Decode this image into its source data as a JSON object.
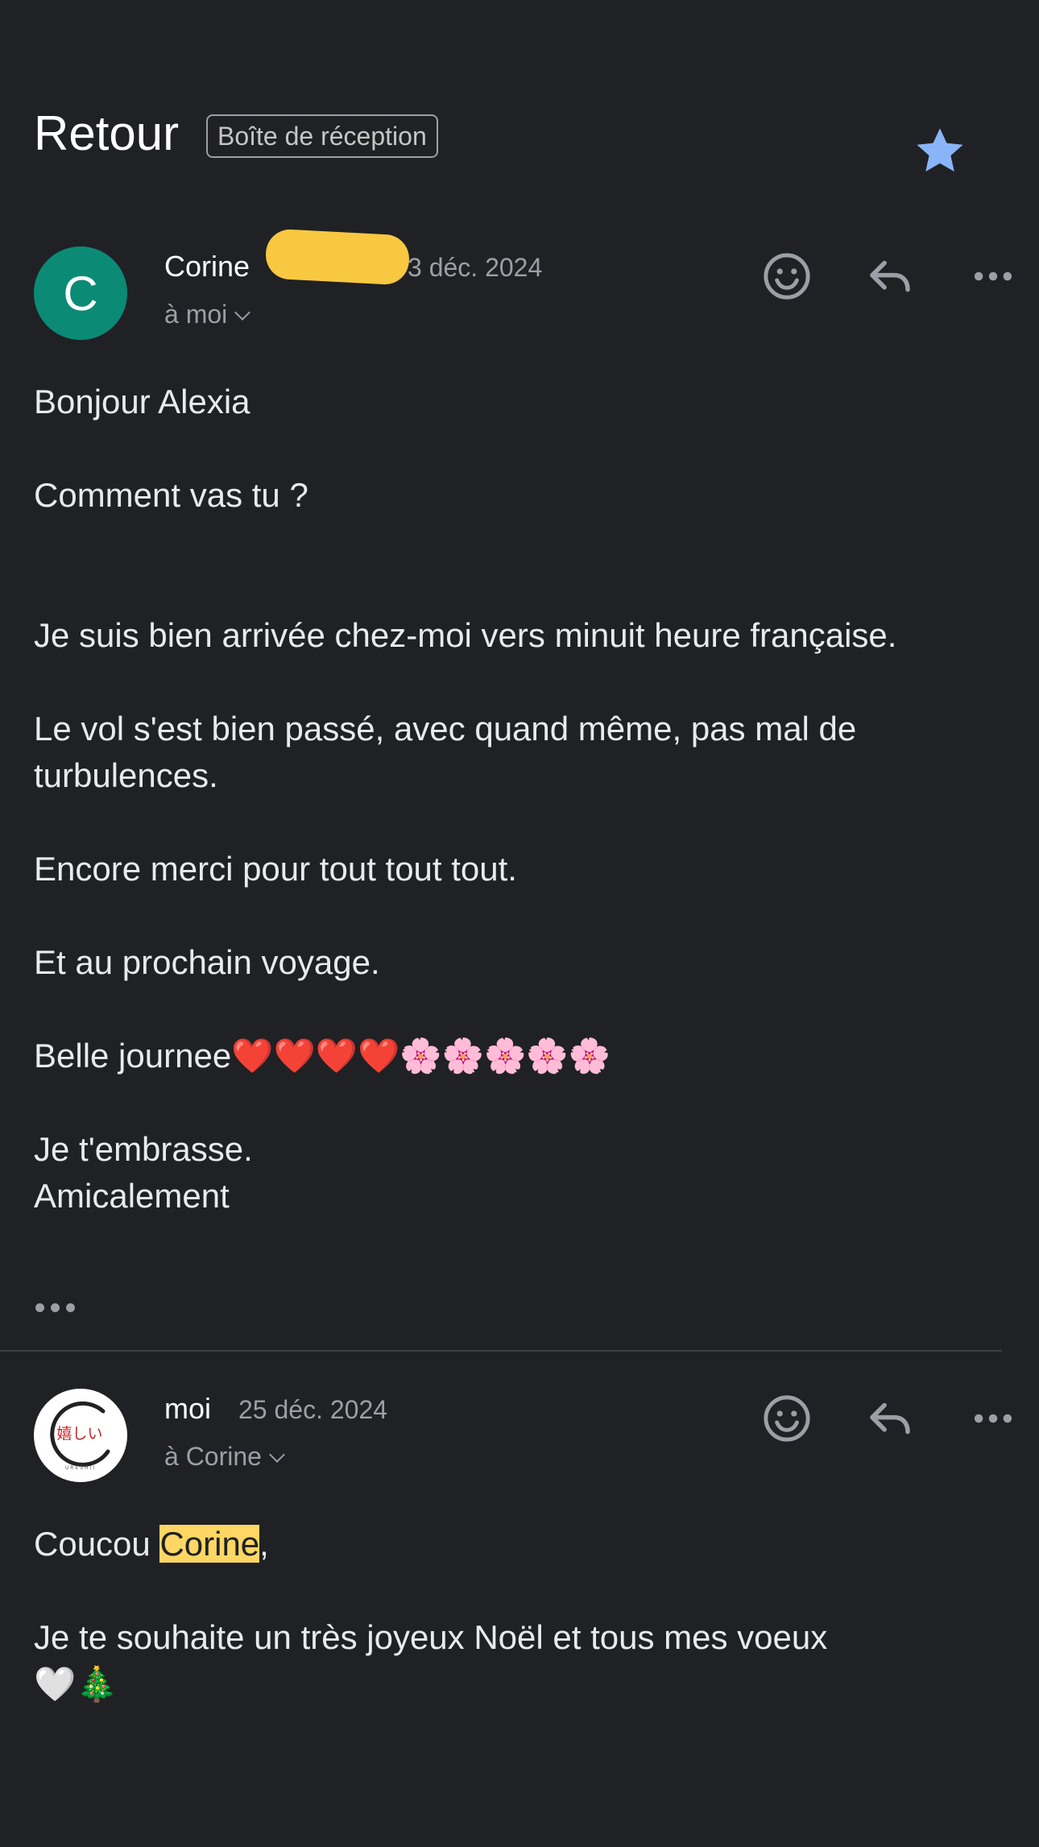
{
  "header": {
    "back_title": "Retour",
    "folder_label": "Boîte de réception",
    "starred": true,
    "star_color": "#8ab4f8"
  },
  "messages": [
    {
      "avatar_letter": "C",
      "avatar_color": "#0b8a76",
      "sender": "Corine",
      "date": "3 déc. 2024",
      "to": "à moi",
      "redacted": true,
      "body": [
        "Bonjour Alexia",
        "Comment vas tu ?",
        "Je suis bien arrivée chez-moi vers minuit heure française.",
        "Le vol s'est bien passé, avec quand même, pas mal de turbulences.",
        "Encore merci pour tout tout tout.",
        "Et au prochain voyage.",
        "Belle journee❤️❤️❤️❤️🌸🌸🌸🌸🌸",
        "Je t'embrasse.",
        "Amicalement"
      ]
    },
    {
      "avatar_logo_text": "嬉しい",
      "avatar_logo_caption": "URESHII",
      "sender": "moi",
      "date": "25 déc. 2024",
      "to": "à Corine",
      "greeting_prefix": "Coucou ",
      "greeting_name": "Corine",
      "greeting_suffix": ",",
      "body": [
        "Je te souhaite un très joyeux Noël et tous mes voeux",
        "🤍🎄"
      ]
    }
  ],
  "icons": {
    "star": "star-icon",
    "emoji": "add-reaction-icon",
    "reply": "reply-icon",
    "more": "more-horizontal-icon",
    "trimmed": "show-trimmed-content-icon"
  }
}
